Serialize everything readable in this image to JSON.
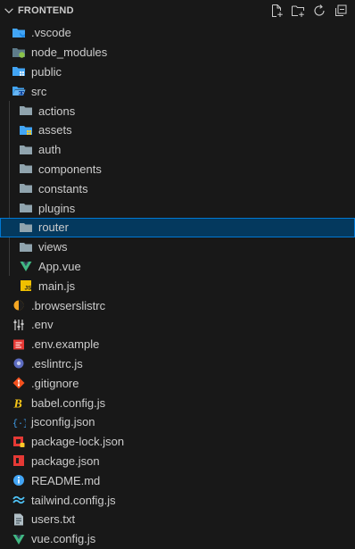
{
  "explorer": {
    "title": "FRONTEND",
    "actions": [
      "new-file",
      "new-folder",
      "refresh",
      "collapse-all"
    ]
  },
  "tree": {
    "items": [
      {
        "label": ".vscode",
        "icon": "folder-vscode-icon",
        "color": "#3a8ee6"
      },
      {
        "label": "node_modules",
        "icon": "folder-node-icon",
        "color": "#8bc34a"
      },
      {
        "label": "public",
        "icon": "folder-public-icon",
        "color": "#3a8ee6"
      },
      {
        "label": "src",
        "icon": "folder-src-open-icon",
        "color": "#3a8ee6"
      },
      {
        "label": "actions",
        "icon": "folder-icon",
        "color": "#90a4ae"
      },
      {
        "label": "assets",
        "icon": "folder-assets-icon",
        "color": "#3a8ee6"
      },
      {
        "label": "auth",
        "icon": "folder-icon",
        "color": "#90a4ae"
      },
      {
        "label": "components",
        "icon": "folder-icon",
        "color": "#90a4ae"
      },
      {
        "label": "constants",
        "icon": "folder-icon",
        "color": "#90a4ae"
      },
      {
        "label": "plugins",
        "icon": "folder-icon",
        "color": "#90a4ae"
      },
      {
        "label": "router",
        "icon": "folder-icon",
        "color": "#90a4ae"
      },
      {
        "label": "views",
        "icon": "folder-icon",
        "color": "#90a4ae"
      },
      {
        "label": "App.vue",
        "icon": "vue-icon",
        "color": "#41b883"
      },
      {
        "label": "main.js",
        "icon": "javascript-icon",
        "color": "#f0c000"
      },
      {
        "label": ".browserslistrc",
        "icon": "browserslist-icon",
        "color": "#f5a623"
      },
      {
        "label": ".env",
        "icon": "env-icon",
        "color": "#cccccc"
      },
      {
        "label": ".env.example",
        "icon": "env-example-icon",
        "color": "#e53935"
      },
      {
        "label": ".eslintrc.js",
        "icon": "eslint-icon",
        "color": "#5c6bc0"
      },
      {
        "label": ".gitignore",
        "icon": "git-icon",
        "color": "#f4511e"
      },
      {
        "label": "babel.config.js",
        "icon": "babel-icon",
        "color": "#f5c518"
      },
      {
        "label": "jsconfig.json",
        "icon": "json-braces-icon",
        "color": "#42a5f5"
      },
      {
        "label": "package-lock.json",
        "icon": "npm-lock-icon",
        "color": "#e53935"
      },
      {
        "label": "package.json",
        "icon": "npm-icon",
        "color": "#e53935"
      },
      {
        "label": "README.md",
        "icon": "info-icon",
        "color": "#42a5f5"
      },
      {
        "label": "tailwind.config.js",
        "icon": "tailwind-icon",
        "color": "#4fc3f7"
      },
      {
        "label": "users.txt",
        "icon": "text-file-icon",
        "color": "#b0bec5"
      },
      {
        "label": "vue.config.js",
        "icon": "vue-config-icon",
        "color": "#41b883"
      }
    ]
  }
}
